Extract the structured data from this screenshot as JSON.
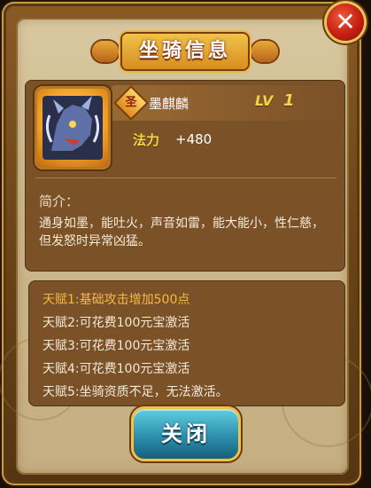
{
  "dialog": {
    "title": "坐骑信息",
    "close_icon_glyph": "✕",
    "close_button_label": "关闭"
  },
  "mount": {
    "badge": "圣",
    "name": "墨麒麟",
    "level_label": "LV",
    "level_value": "1",
    "stat_label": "法力",
    "stat_value": "+480",
    "portrait_icon": "qilin-portrait-icon"
  },
  "description": {
    "label": "简介：",
    "text": "通身如墨，能吐火，声音如雷，能大能小，性仁慈，但发怒时异常凶猛。"
  },
  "talents": [
    {
      "text": "天赋1:基础攻击增加500点",
      "active": true
    },
    {
      "text": "天赋2:可花费100元宝激活",
      "active": false
    },
    {
      "text": "天赋3:可花费100元宝激活",
      "active": false
    },
    {
      "text": "天赋4:可花费100元宝激活",
      "active": false
    },
    {
      "text": "天赋5:坐骑资质不足，无法激活。",
      "active": false
    }
  ],
  "colors": {
    "active_talent": "#f6b84a",
    "inactive_talent": "#f2ead8",
    "gold_text": "#f3d54a"
  }
}
